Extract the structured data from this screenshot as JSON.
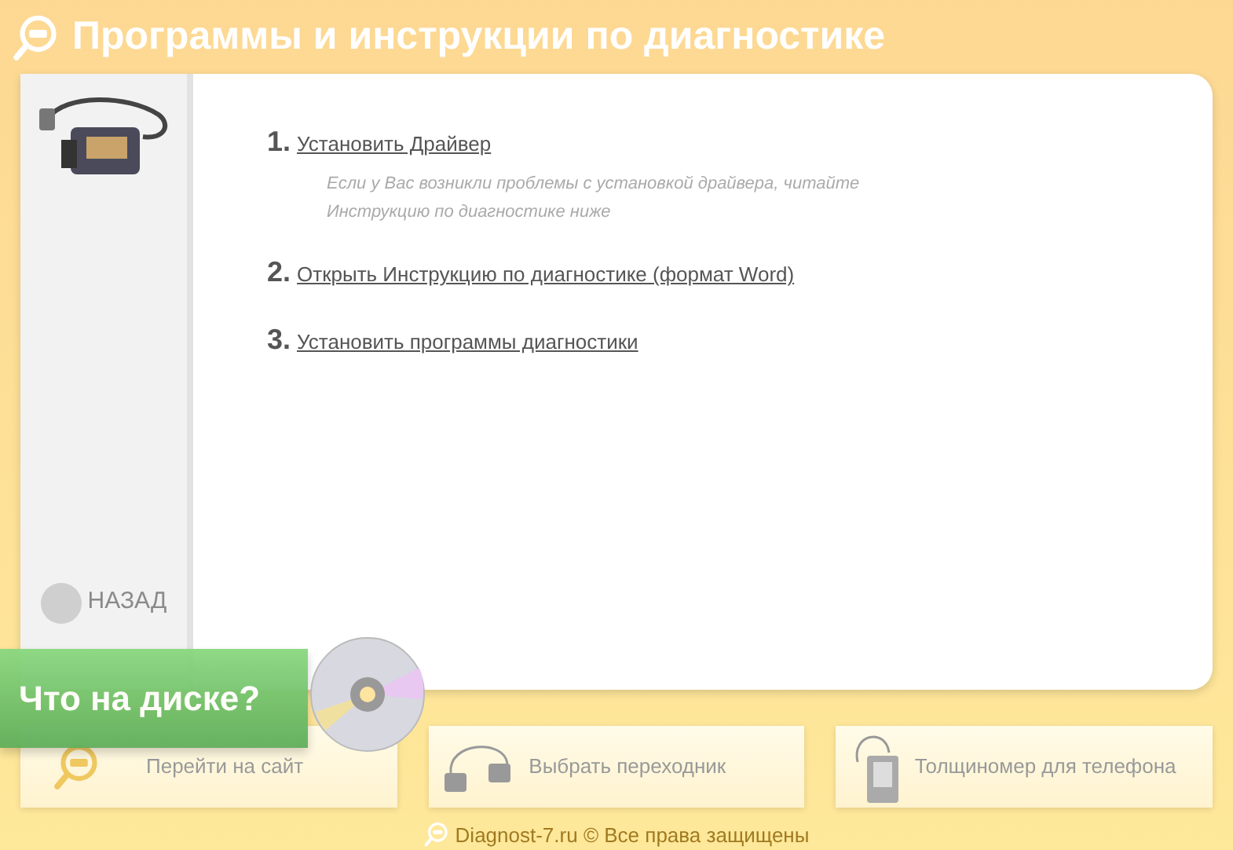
{
  "header": {
    "title": "Программы и инструкции по диагностике"
  },
  "sidebar": {
    "back_button": "НАЗАД"
  },
  "steps": [
    {
      "number": "1.",
      "link": "Установить Драйвер",
      "note": "Если у Вас возникли проблемы с установкой драйвера, читайте Инструкцию по диагностике ниже"
    },
    {
      "number": "2.",
      "link": "Открыть Инструкцию по диагностике (формат Word)"
    },
    {
      "number": "3.",
      "link": "Установить программы диагностики"
    }
  ],
  "banner": {
    "label": "Что на диске?"
  },
  "bottom_buttons": [
    {
      "kind": "site",
      "label": "Перейти на сайт"
    },
    {
      "kind": "adapter",
      "label": "Выбрать переходник"
    },
    {
      "kind": "gauge",
      "label": "Толщиномер для телефона"
    }
  ],
  "footer": {
    "text": "Diagnost-7.ru © Все права защищены"
  }
}
